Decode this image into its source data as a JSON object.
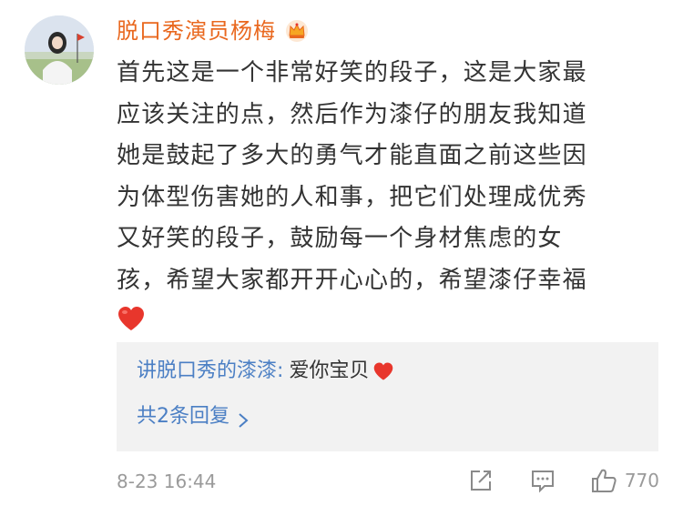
{
  "comment": {
    "username": "脱口秀演员杨梅",
    "badge_icon": "crown-badge-icon",
    "lines": [
      "首先这是一个非常好笑的段子，这是大家最",
      "应该关注的点，然后作为漆仔的朋友我知道",
      "她是鼓起了多大的勇气才能直面之前这些因",
      "为体型伤害她的人和事，把它们处理成优秀",
      "又好笑的段子，鼓励每一个身材焦虑的女",
      "孩，希望大家都开开心心的，希望漆仔幸福"
    ],
    "emoji": "red-heart-icon",
    "timestamp": "8-23 16:44",
    "like_count": "770"
  },
  "reply": {
    "author": "讲脱口秀的漆漆",
    "colon": ":",
    "text": "爱你宝贝",
    "emoji": "red-heart-icon",
    "more_replies_label": "共2条回复"
  },
  "colors": {
    "username": "#e9681f",
    "link": "#4b7fc4",
    "body_text": "#333333",
    "meta_text": "#9a9a9a",
    "reply_bg": "#f2f2f2",
    "heart": "#e8362c"
  }
}
